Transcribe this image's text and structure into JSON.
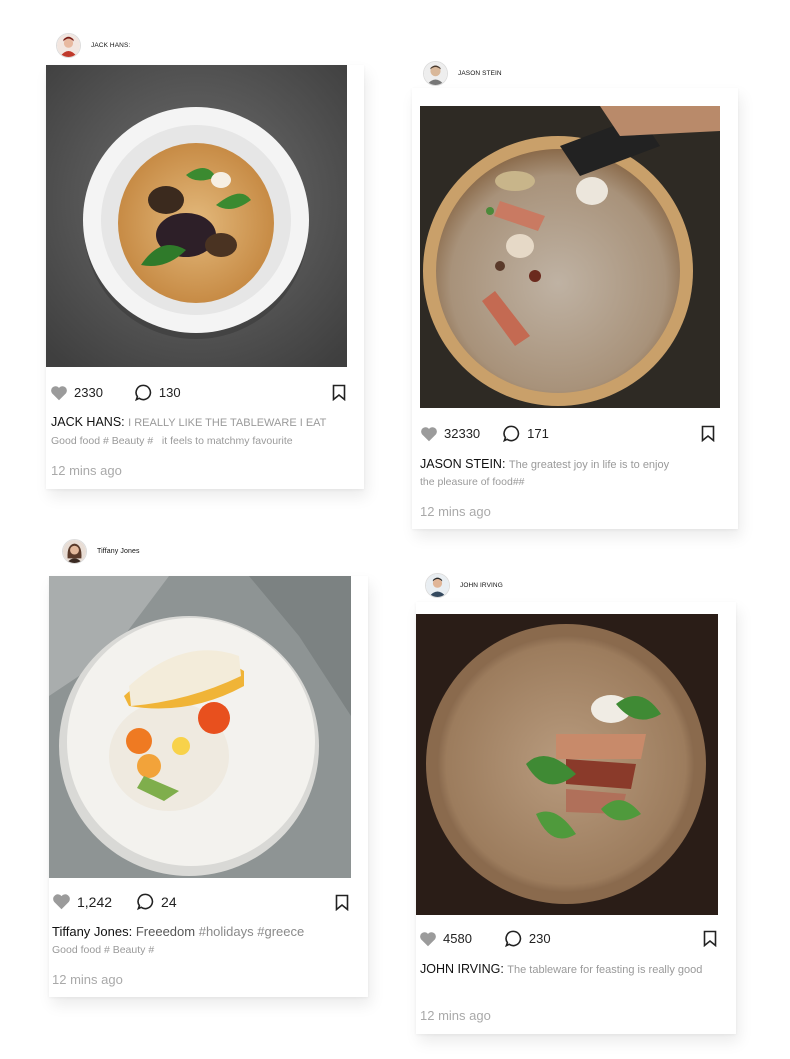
{
  "posts": [
    {
      "user": "JACK HANS:",
      "author": "JACK HANS:",
      "likes": "2330",
      "comments": "130",
      "caption": "I REALLY LIKE THE TABLEWARE I EAT",
      "tags": "Good food # Beauty #   it feels to matchmy favourite",
      "time": "12 mins ago",
      "avatar_color": "#c0392b"
    },
    {
      "user": "JASON STEIN",
      "author": "JASON STEIN:",
      "likes": "32330",
      "comments": "171",
      "caption": "The greatest joy in life is to enjoy",
      "tags": "the pleasure of food##",
      "time": "12 mins ago",
      "avatar_color": "#d9b89a"
    },
    {
      "user": "Tiffany Jones",
      "author": "Tiffany Jones:",
      "likes": "1,242",
      "comments": "24",
      "caption": "Freeedom",
      "hashtags": "#holidays #greece",
      "tags": "Good food # Beauty #",
      "time": "12 mins ago",
      "avatar_color": "#5a3a2a"
    },
    {
      "user": "JOHN IRVING",
      "author": "JOHN IRVING:",
      "likes": "4580",
      "comments": "230",
      "caption": "The tableware for feasting is really good",
      "time": "12 mins ago",
      "avatar_color": "#34495e"
    }
  ],
  "icons": {
    "like": "heart-icon",
    "comment": "comment-icon",
    "save": "bookmark-icon"
  }
}
